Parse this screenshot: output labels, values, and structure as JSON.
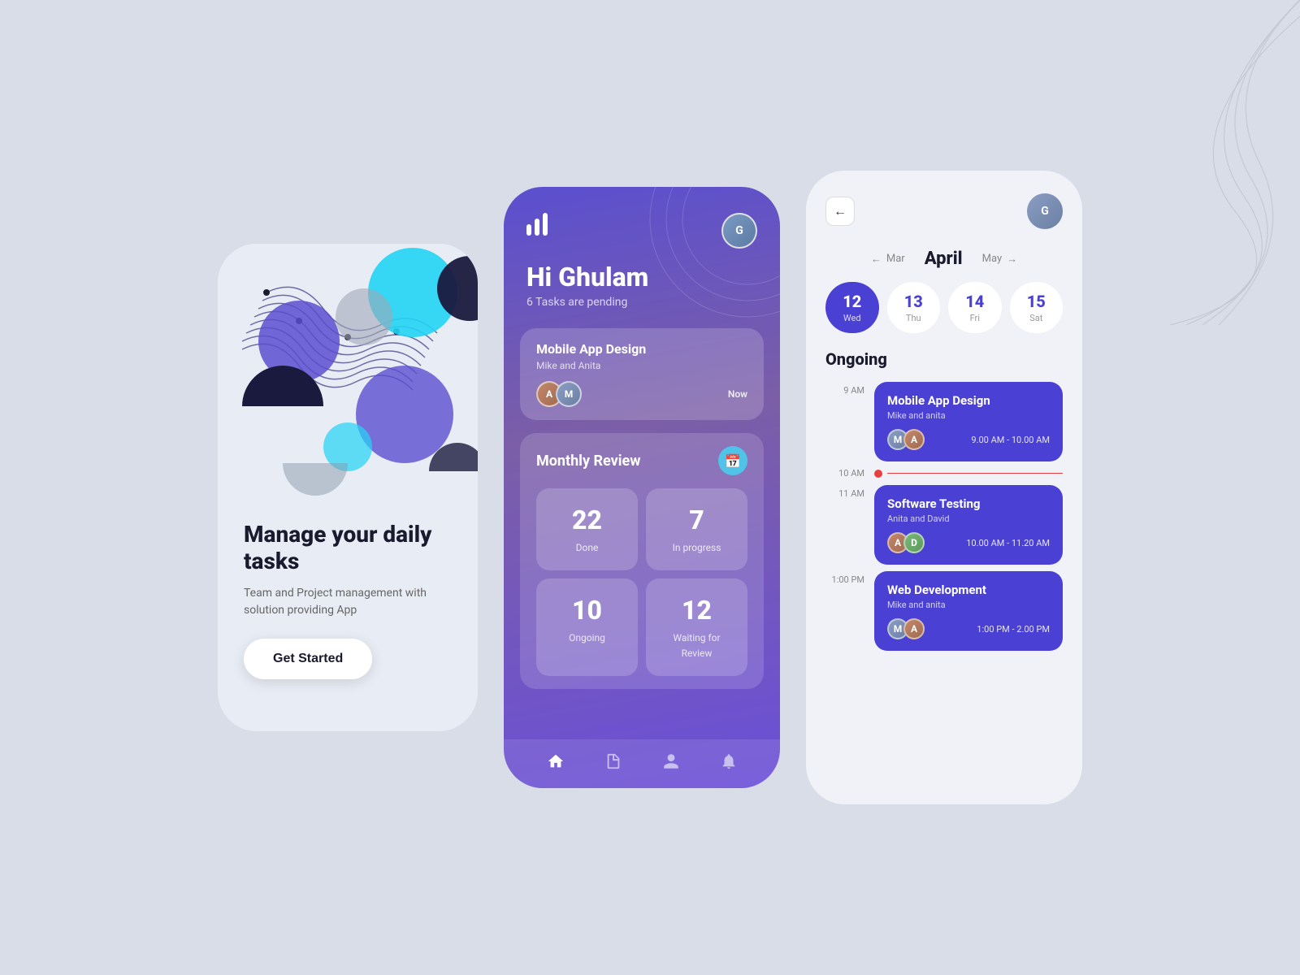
{
  "background": "#d8dde8",
  "card1": {
    "title": "Manage your daily tasks",
    "subtitle": "Team and Project management with solution providing App",
    "cta": "Get Started"
  },
  "card2": {
    "logo": "|||",
    "greeting": "Hi Ghulam",
    "pending": "6 Tasks are pending",
    "task": {
      "title": "Mobile App Design",
      "subtitle": "Mike and Anita",
      "time": "Now"
    },
    "monthly_review": {
      "title": "Monthly Review",
      "stats": [
        {
          "number": "22",
          "label": "Done"
        },
        {
          "number": "7",
          "label": "In progress"
        },
        {
          "number": "10",
          "label": "Ongoing"
        },
        {
          "number": "12",
          "label": "Waiting for Review"
        }
      ]
    },
    "nav": [
      "home",
      "file",
      "person",
      "bell"
    ]
  },
  "card3": {
    "month": "April",
    "prev_month": "Mar",
    "next_month": "May",
    "dates": [
      {
        "num": "12",
        "day": "Wed",
        "active": true
      },
      {
        "num": "13",
        "day": "Thu",
        "active": false
      },
      {
        "num": "14",
        "day": "Fri",
        "active": false
      },
      {
        "num": "15",
        "day": "Sat",
        "active": false
      }
    ],
    "ongoing_label": "Ongoing",
    "events": [
      {
        "time_label": "9 AM",
        "title": "Mobile App Design",
        "subtitle": "Mike and anita",
        "time_range": "9.00 AM - 10.00 AM",
        "avatars": [
          "M",
          "A"
        ]
      },
      {
        "time_label": "11 AM",
        "title": "Software Testing",
        "subtitle": "Anita and David",
        "time_range": "10.00 AM - 11.20 AM",
        "avatars": [
          "A",
          "D"
        ]
      },
      {
        "time_label": "1:00 PM",
        "title": "Web Development",
        "subtitle": "Mike and anita",
        "time_range": "1:00 PM - 2.00 PM",
        "avatars": [
          "M",
          "A"
        ]
      }
    ],
    "current_time_label": "10 AM"
  }
}
